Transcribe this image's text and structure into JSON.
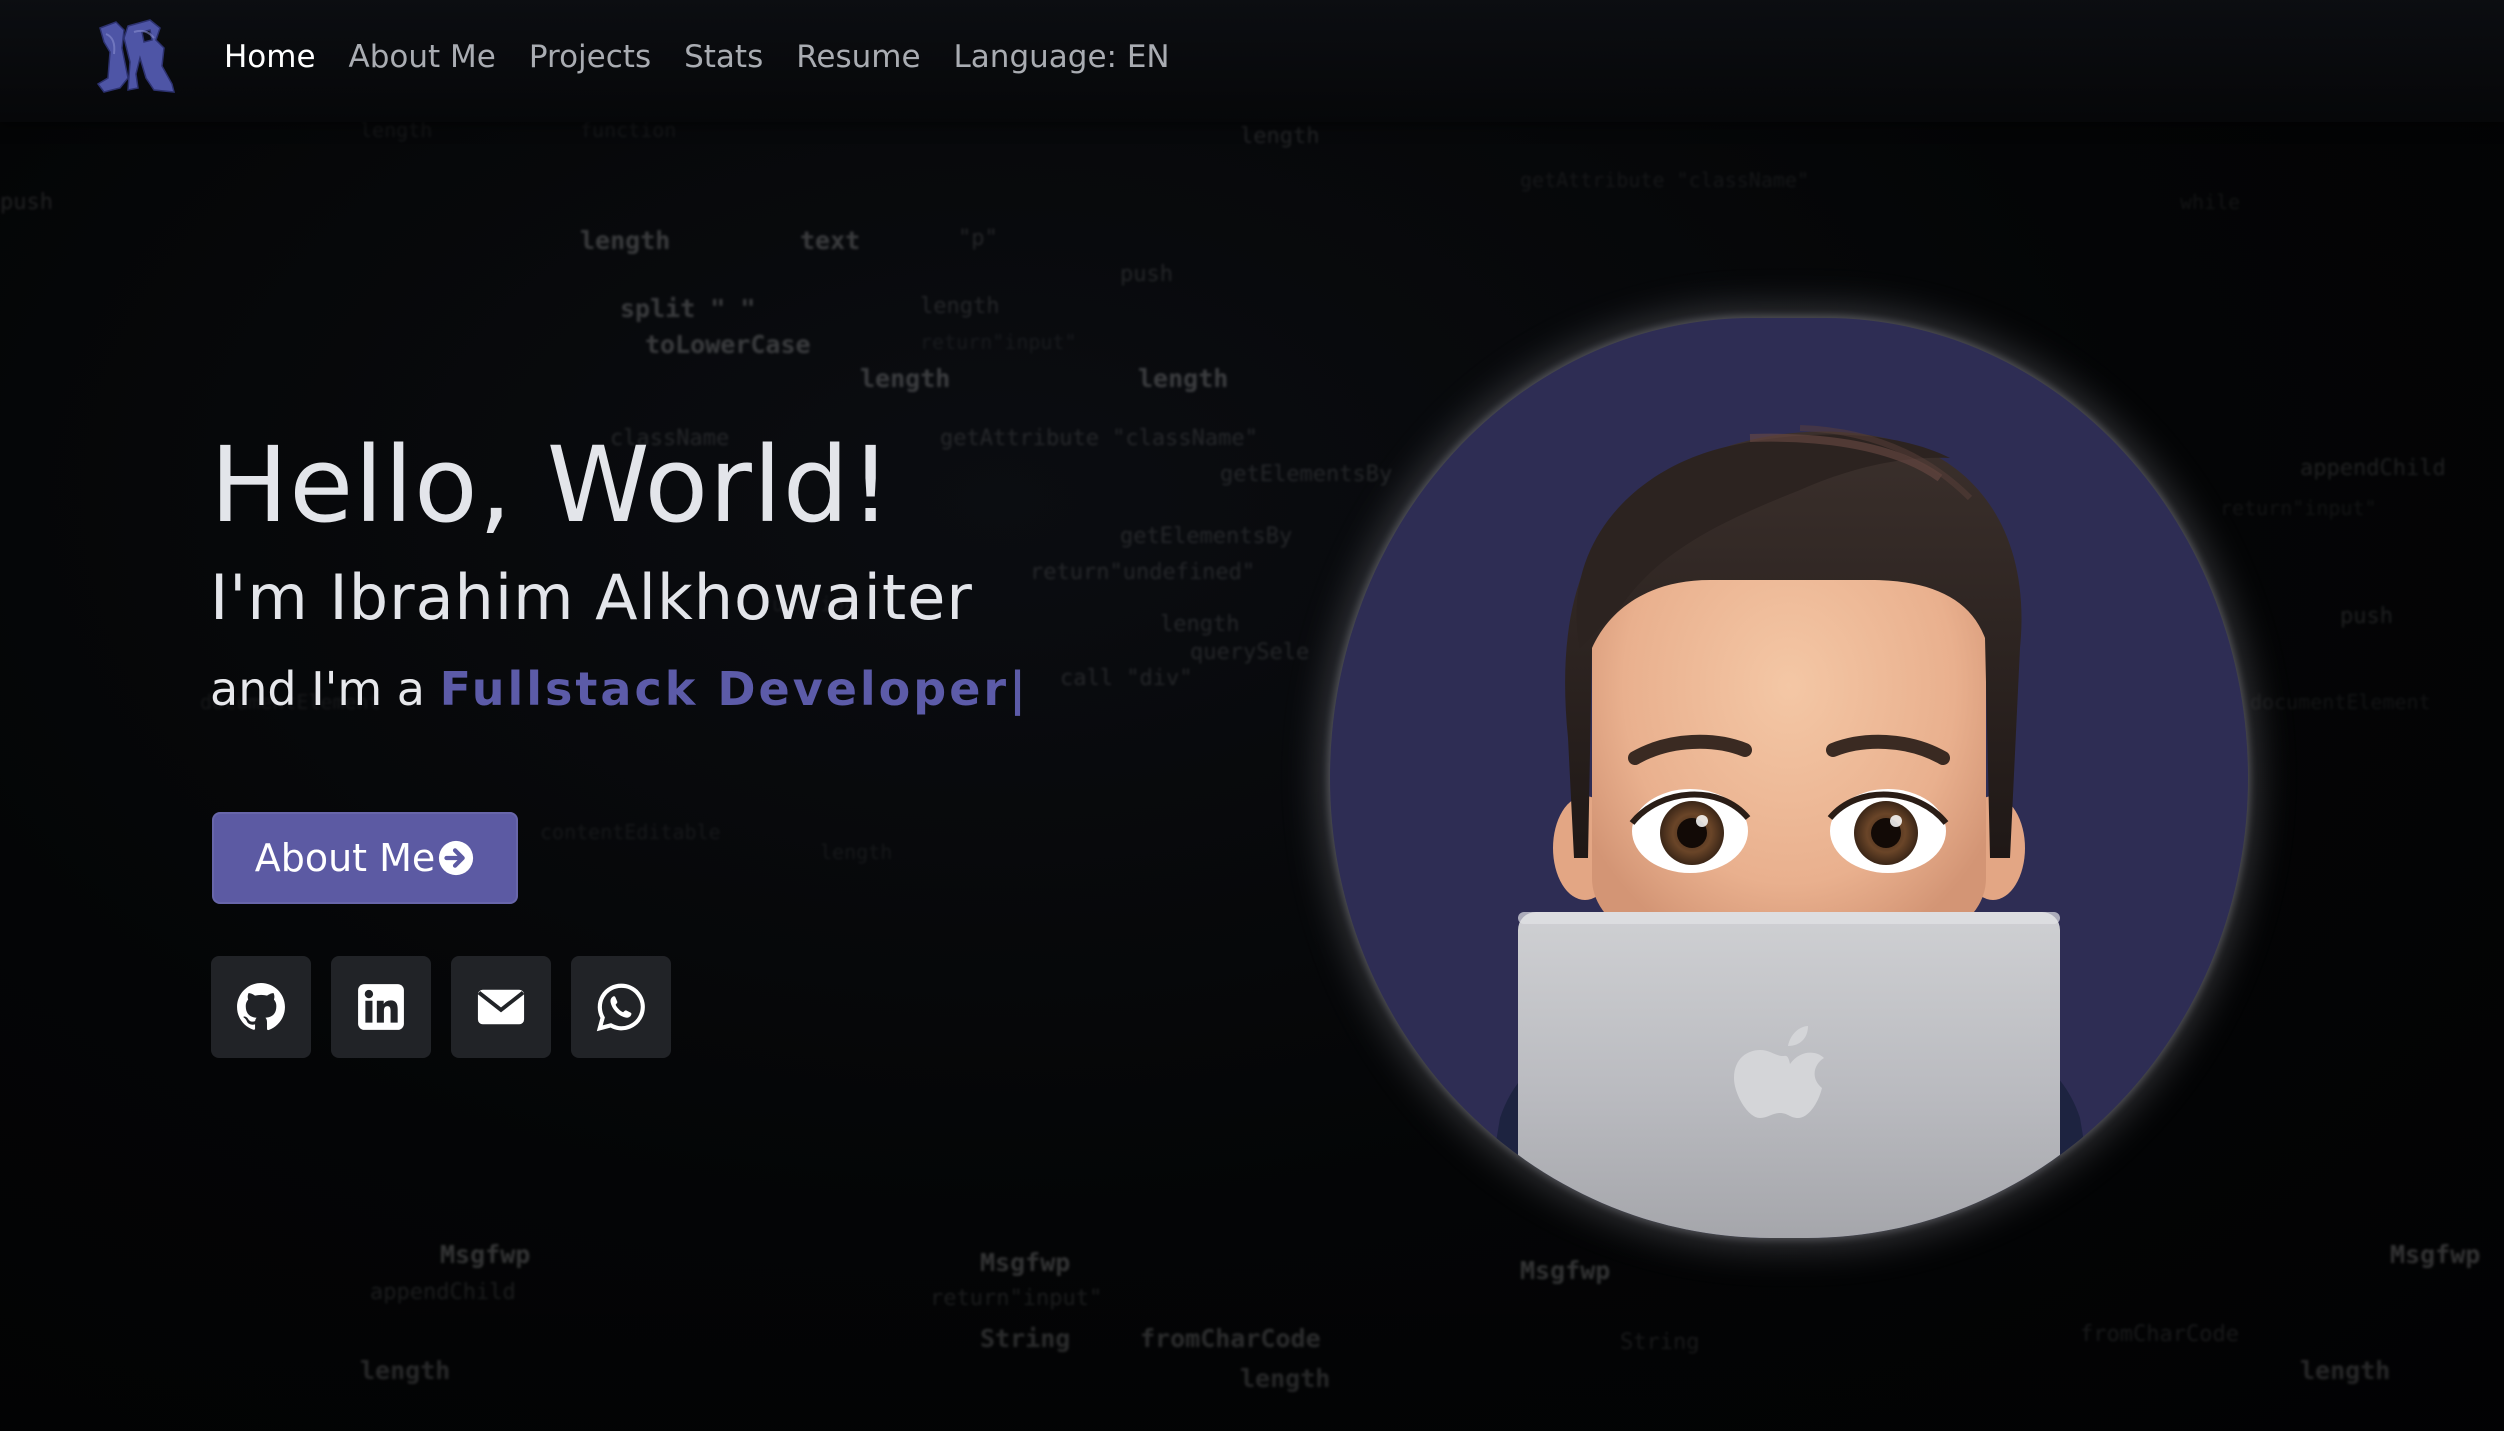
{
  "colors": {
    "accent": "#5c5aa3",
    "accent_text": "#5c5ba8",
    "background": "#030405",
    "social_button_bg": "#212327",
    "avatar_bg": "#2e2d54"
  },
  "navbar": {
    "logo_icon": "monogram-logo-icon",
    "links": [
      {
        "label": "Home",
        "active": true
      },
      {
        "label": "About Me",
        "active": false
      },
      {
        "label": "Projects",
        "active": false
      },
      {
        "label": "Stats",
        "active": false
      },
      {
        "label": "Resume",
        "active": false
      },
      {
        "label": "Language: EN",
        "active": false
      }
    ]
  },
  "hero": {
    "greeting": "Hello, World!",
    "intro": "I'm Ibrahim Alkhowaiter",
    "role_prefix": "and I'm a ",
    "role": "Fullstack Developer",
    "cursor": "|",
    "cta_label": "About Me",
    "cta_icon": "arrow-circle-right-icon"
  },
  "socials": [
    {
      "name": "github",
      "icon": "github-icon"
    },
    {
      "name": "linkedin",
      "icon": "linkedin-icon"
    },
    {
      "name": "email",
      "icon": "envelope-icon"
    },
    {
      "name": "whatsapp",
      "icon": "whatsapp-icon"
    }
  ],
  "avatar": {
    "icon": "memoji-laptop-avatar"
  },
  "background_code": [
    "length",
    "text",
    "\"p\"",
    "push",
    "function",
    "split \" \"",
    "toLowerCase",
    "className",
    "getAttribute \"className\"",
    "getElementsBy",
    "return\"undefined\"",
    "querySele",
    "call \"div\"",
    "documentElement",
    "contentEditable",
    "appendChild",
    "return\"input\"",
    "while",
    "Msgfwp",
    "String",
    "fromCharCode"
  ]
}
